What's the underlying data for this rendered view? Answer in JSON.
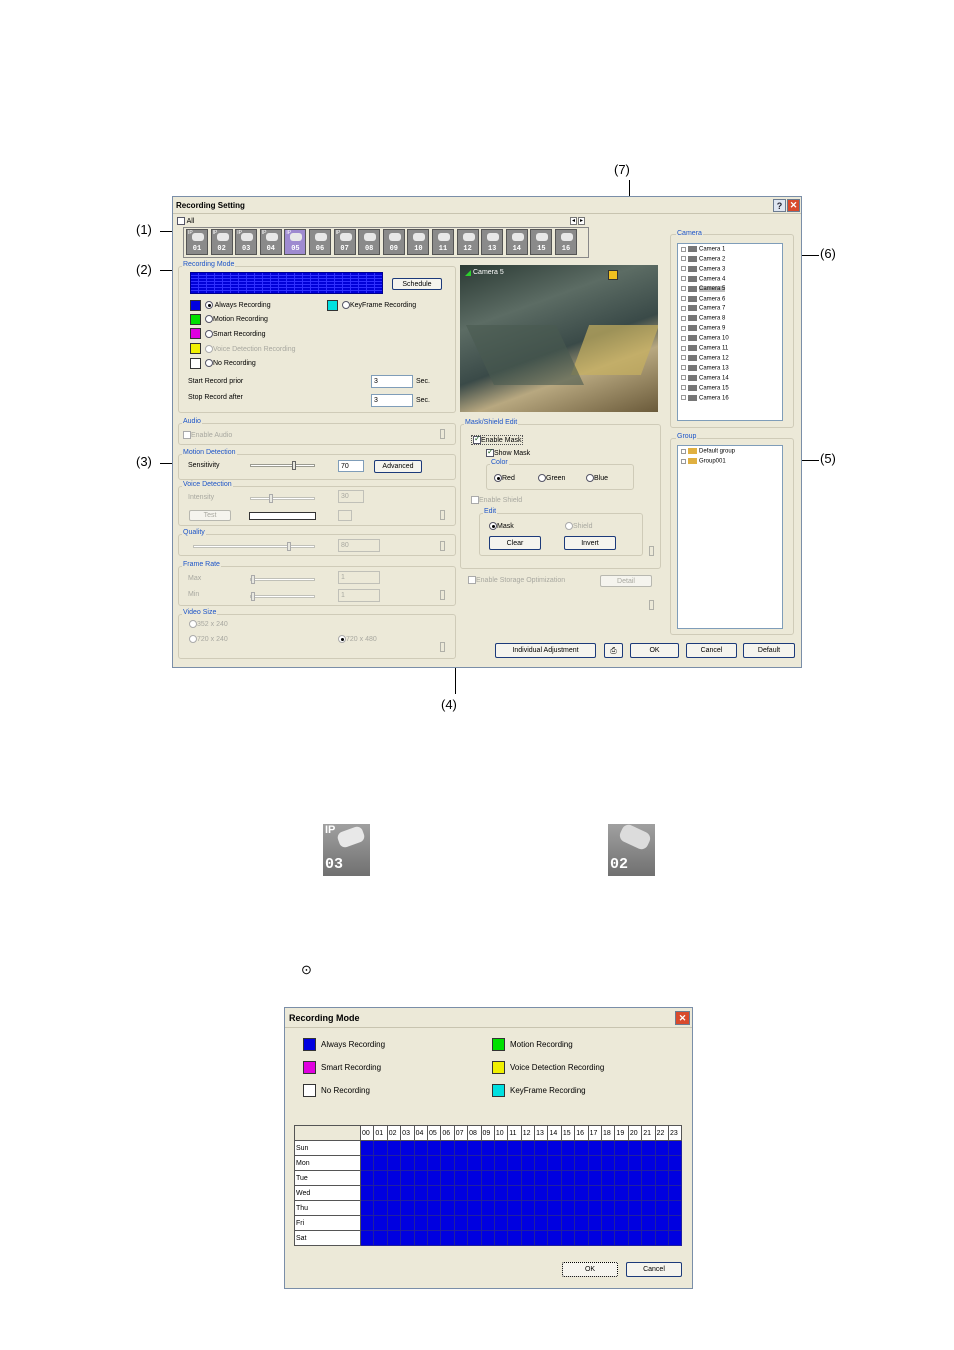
{
  "callouts": {
    "c1": "(1)",
    "c2": "(2)",
    "c3": "(3)",
    "c4": "(4)",
    "c5": "(5)",
    "c6": "(6)",
    "c7": "(7)"
  },
  "window": {
    "title": "Recording Setting",
    "help_btn": "?",
    "close_btn": "✕",
    "all_label": "All",
    "cameras": [
      {
        "num": "01",
        "ip": "IP"
      },
      {
        "num": "02",
        "ip": "IP"
      },
      {
        "num": "03",
        "ip": "IP"
      },
      {
        "num": "04",
        "ip": "IP"
      },
      {
        "num": "05",
        "ip": "IP"
      },
      {
        "num": "06",
        "ip": ""
      },
      {
        "num": "07",
        "ip": "IP"
      },
      {
        "num": "08",
        "ip": ""
      },
      {
        "num": "09",
        "ip": ""
      },
      {
        "num": "10",
        "ip": ""
      },
      {
        "num": "11",
        "ip": ""
      },
      {
        "num": "12",
        "ip": ""
      },
      {
        "num": "13",
        "ip": ""
      },
      {
        "num": "14",
        "ip": ""
      },
      {
        "num": "15",
        "ip": ""
      },
      {
        "num": "16",
        "ip": ""
      }
    ],
    "recording_mode": {
      "title": "Recording Mode",
      "schedule_btn": "Schedule",
      "always": "Always Recording",
      "motion": "Motion Recording",
      "smart": "Smart Recording",
      "voice": "Voice Detection Recording",
      "none": "No Recording",
      "keyframe": "KeyFrame Recording",
      "start_label": "Start Record prior",
      "start_value": "3",
      "stop_label": "Stop Record after",
      "stop_value": "3",
      "sec": "Sec."
    },
    "audio": {
      "title": "Audio",
      "enable": "Enable Audio"
    },
    "motion_detection": {
      "title": "Motion Detection",
      "sensitivity": "Sensitivity",
      "value": "70",
      "advanced_btn": "Advanced",
      "level": 0.7
    },
    "voice_detection": {
      "title": "Voice Detection",
      "intensity": "Intensity",
      "value": "30",
      "test_btn": "Test",
      "level": 0.3
    },
    "quality": {
      "title": "Quality",
      "value": "80",
      "level": 0.8
    },
    "frame_rate": {
      "title": "Frame Rate",
      "max": "Max",
      "min": "Min",
      "max_value": "1",
      "min_value": "1"
    },
    "video_size": {
      "title": "Video Size",
      "opt1": "352 x 240",
      "opt2": "720 x 240",
      "opt3": "720 x 480"
    },
    "video": {
      "label": "Camera 5"
    },
    "mask": {
      "title": "Mask/Shield Edit",
      "enable_mask": "Enable Mask",
      "show_mask": "Show Mask",
      "color": "Color",
      "red": "Red",
      "green": "Green",
      "blue": "Blue",
      "enable_shield": "Enable Shield",
      "edit": "Edit",
      "mask_opt": "Mask",
      "shield_opt": "Shield",
      "clear_btn": "Clear",
      "invert_btn": "Invert",
      "storage_opt": "Enable Storage Optimization",
      "detail_btn": "Detail"
    },
    "camera_panel": {
      "title": "Camera",
      "items": [
        "Camera 1",
        "Camera 2",
        "Camera 3",
        "Camera 4",
        "Camera 5",
        "Camera 6",
        "Camera 7",
        "Camera 8",
        "Camera 9",
        "Camera 10",
        "Camera 11",
        "Camera 12",
        "Camera 13",
        "Camera 14",
        "Camera 15",
        "Camera 16"
      ]
    },
    "group_panel": {
      "title": "Group",
      "items": [
        "Default group",
        "Group001"
      ]
    },
    "buttons": {
      "individual": "Individual Adjustment",
      "ok": "OK",
      "cancel": "Cancel",
      "default": "Default"
    }
  },
  "icons_sample": {
    "ip_cam_num": "03",
    "ip_label": "IP",
    "analog_cam_num": "02",
    "radio_symbol": "⊙"
  },
  "recording_dialog": {
    "title": "Recording Mode",
    "close_btn": "✕",
    "legend": {
      "always": "Always Recording",
      "motion": "Motion Recording",
      "smart": "Smart Recording",
      "voice": "Voice Detection Recording",
      "none": "No Recording",
      "keyframe": "KeyFrame Recording"
    },
    "hours": [
      "00",
      "01",
      "02",
      "03",
      "04",
      "05",
      "06",
      "07",
      "08",
      "09",
      "10",
      "11",
      "12",
      "13",
      "14",
      "15",
      "16",
      "17",
      "18",
      "19",
      "20",
      "21",
      "22",
      "23"
    ],
    "days": [
      "Sun",
      "Mon",
      "Tue",
      "Wed",
      "Thu",
      "Fri",
      "Sat"
    ],
    "ok_btn": "OK",
    "cancel_btn": "Cancel"
  },
  "colors": {
    "always": "#0000e0",
    "motion": "#00e000",
    "smart": "#e000e0",
    "voice": "#f0f000",
    "none": "#ffffff",
    "keyframe": "#00e0e0"
  }
}
